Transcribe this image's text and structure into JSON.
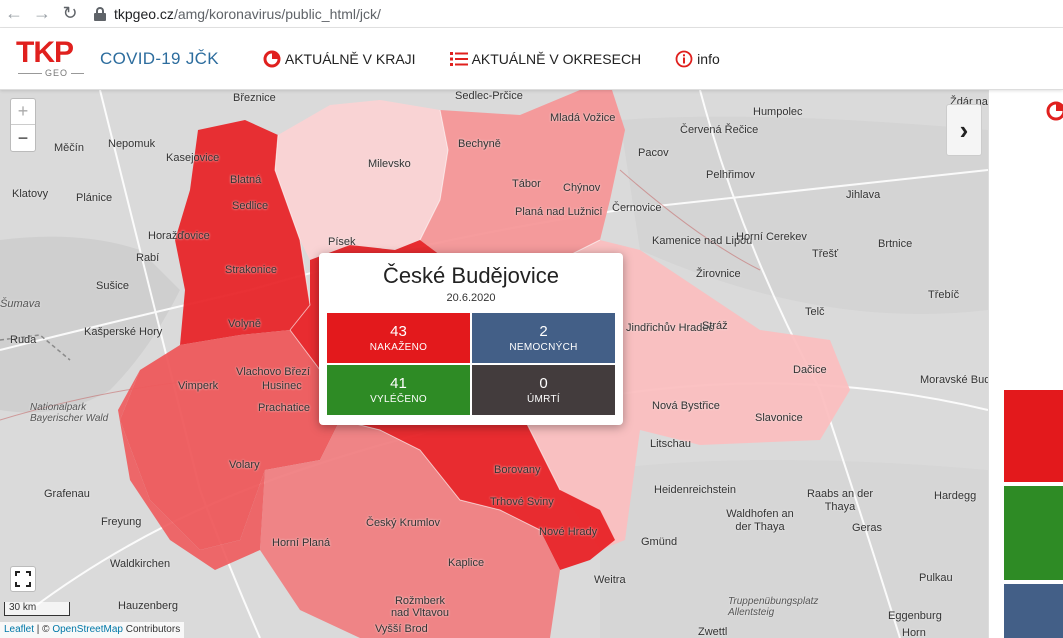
{
  "browser": {
    "url_host": "tkpgeo.cz",
    "url_path": "/amg/koronavirus/public_html/jck/"
  },
  "header": {
    "logo_text": "TKP",
    "logo_sub": "GEO",
    "title": "COVID-19 JČK",
    "menu": [
      {
        "label": "AKTUÁLNĚ V KRAJI",
        "icon": "pie-chart-icon"
      },
      {
        "label": "AKTUÁLNĚ V OKRESECH",
        "icon": "list-icon"
      },
      {
        "label": "info",
        "icon": "info-icon"
      }
    ]
  },
  "map": {
    "places": [
      "Březnice",
      "Sedlec-Prčice",
      "Humpolec",
      "Ždár na",
      "Mladá Vožice",
      "Nepomuk",
      "Měčín",
      "Kasejovice",
      "Blatná",
      "Milevsko",
      "Bechyně",
      "Tábor",
      "Červená Řečice",
      "Pacov",
      "Pelhřimov",
      "Jihlava",
      "Klatovy",
      "Plánice",
      "Sedlice",
      "Chýnov",
      "Planá nad Lužnicí",
      "Černovice",
      "Kamenice nad Lipou",
      "Horní Cerekev",
      "Brtnice",
      "Horažďovice",
      "Strakonice",
      "Písek",
      "Třešť",
      "Rabí",
      "Žirovnice",
      "Sušice",
      "Volyně",
      "Jindřichův Hradec",
      "Stráž",
      "Telč",
      "Třebíč",
      "Šumava",
      "Kašperské Hory",
      "Dačice",
      "Moravské Budějovice",
      "Ruda",
      "Vlachovo Březí",
      "Husinec",
      "Vimperk",
      "Prachatice",
      "Nationalpark Bayerischer Wald",
      "Slavonice",
      "Nová Bystřice",
      "Litschau",
      "Heidenreichstein",
      "Borovany",
      "Trhové Sviny",
      "Grafenau",
      "Volary",
      "Horní Planá",
      "Český Krumlov",
      "Vyšší Brod",
      "Kaplice",
      "Freyung",
      "Waldhofen an der Thaya",
      "Raabs an der Thaya",
      "Hardegg",
      "Gmünd",
      "Nové Hrady",
      "Geras",
      "Waldkirchen",
      "Weitra",
      "Pulkau",
      "Hauzenberg",
      "Rožmberk nad Vltavou",
      "Truppenübungsplatz Allentsteig",
      "Eggenburg",
      "Zwettl",
      "Horn"
    ],
    "zoom_in": "+",
    "zoom_out": "−",
    "scale_label": "30 km",
    "attribution_leaflet": "Leaflet",
    "attribution_sep": " | © ",
    "attribution_osm": "OpenStreetMap",
    "attribution_rest": " Contributors"
  },
  "popup": {
    "title": "České Budějovice",
    "date": "20.6.2020",
    "stats": [
      {
        "value": "43",
        "label": "NAKAŽENO",
        "color": "#e3191c"
      },
      {
        "value": "2",
        "label": "NEMOCNÝCH",
        "color": "#435f87"
      },
      {
        "value": "41",
        "label": "VYLÉČENO",
        "color": "#2e8b25"
      },
      {
        "value": "0",
        "label": "ÚMRTÍ",
        "color": "#433c3d"
      }
    ]
  },
  "colors": {
    "accent_red": "#e0201e",
    "title_blue": "#2d6d9e",
    "district_dark": "#e8262a",
    "district_mid": "#ee5a5c",
    "district_light": "#f59798",
    "district_pale": "#fbd3d4"
  },
  "right_panel": {
    "blocks": [
      "#e3191c",
      "#2e8b25",
      "#435f87"
    ]
  }
}
